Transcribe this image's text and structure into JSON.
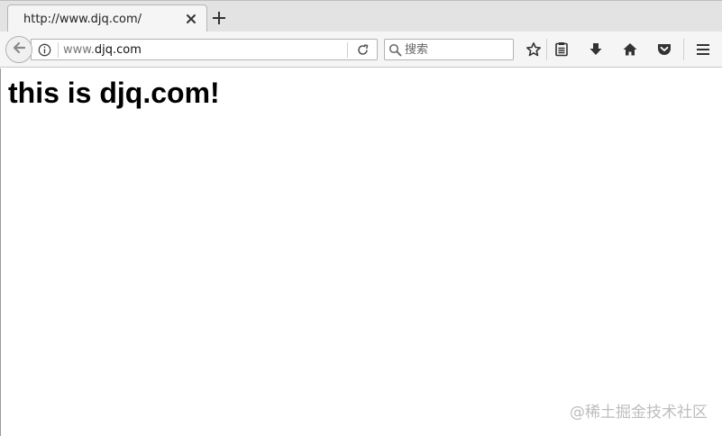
{
  "browser": {
    "tab": {
      "title": "http://www.djq.com/"
    },
    "urlbar": {
      "prefix": "www.",
      "host": "djq.com"
    },
    "searchbar": {
      "placeholder": "搜索"
    }
  },
  "page": {
    "heading": "this is djq.com!"
  },
  "watermark": "@稀土掘金技术社区",
  "icons": [
    "close-icon",
    "new-tab-icon",
    "back-arrow-icon",
    "info-icon",
    "reload-icon",
    "search-icon",
    "bookmark-star-icon",
    "reading-list-icon",
    "download-icon",
    "home-icon",
    "pocket-icon",
    "menu-icon"
  ]
}
